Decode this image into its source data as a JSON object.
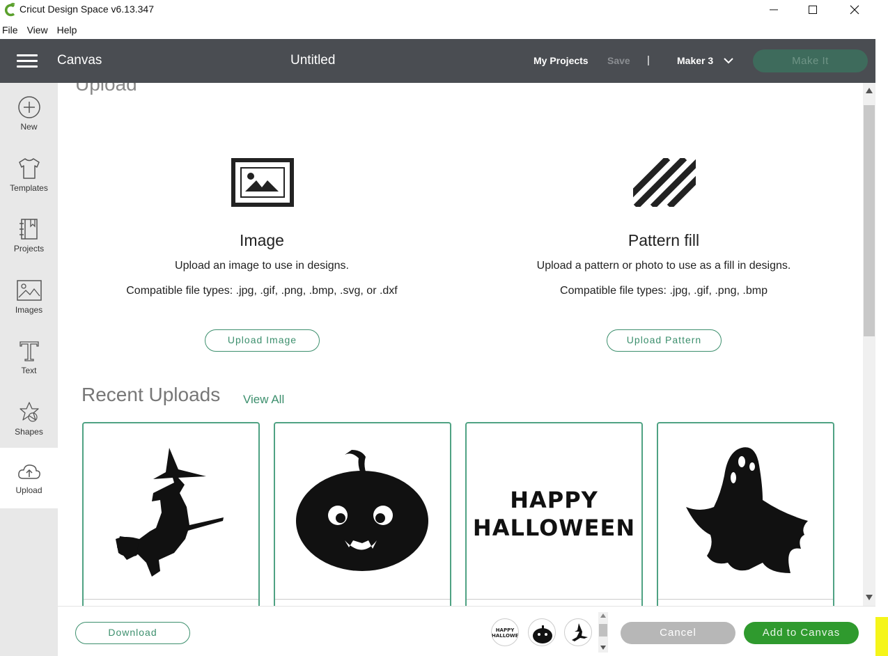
{
  "window": {
    "title": "Cricut Design Space  v6.13.347",
    "minimize_glyph": "—",
    "maximize_glyph": "☐",
    "close_glyph": "✕"
  },
  "menu": {
    "items": [
      "File",
      "View",
      "Help"
    ]
  },
  "topbar": {
    "canvas_label": "Canvas",
    "document_title": "Untitled",
    "my_projects": "My Projects",
    "save": "Save",
    "separator": "|",
    "machine": "Maker 3",
    "make_it": "Make It"
  },
  "sidebar": {
    "items": [
      {
        "label": "New",
        "icon": "plus-circle-icon"
      },
      {
        "label": "Templates",
        "icon": "tshirt-icon"
      },
      {
        "label": "Projects",
        "icon": "notebook-icon"
      },
      {
        "label": "Images",
        "icon": "image-icon"
      },
      {
        "label": "Text",
        "icon": "text-T-icon"
      },
      {
        "label": "Shapes",
        "icon": "shapes-icon"
      },
      {
        "label": "Upload",
        "icon": "cloud-upload-icon",
        "active": true
      }
    ]
  },
  "upload": {
    "section_title": "Upload",
    "image": {
      "heading": "Image",
      "description": "Upload an image to use in designs.",
      "types": "Compatible file types: .jpg, .gif, .png, .bmp, .svg, or .dxf",
      "button": "Upload Image"
    },
    "pattern": {
      "heading": "Pattern fill",
      "description": "Upload a pattern or photo to use as a fill in designs.",
      "types": "Compatible file types: .jpg, .gif, .png, .bmp",
      "button": "Upload Pattern"
    }
  },
  "recent": {
    "title": "Recent Uploads",
    "view_all": "View All",
    "items": [
      {
        "name": "witch-silhouette"
      },
      {
        "name": "jack-o-lantern"
      },
      {
        "name": "happy-halloween-text",
        "line1": "HAPPY",
        "line2": "HALLOWEEN"
      },
      {
        "name": "ghost-silhouette"
      }
    ]
  },
  "bottombar": {
    "download": "Download",
    "thumb_text": "HAPPY HALLOWEEN",
    "cancel": "Cancel",
    "add_to_canvas": "Add to Canvas"
  },
  "colors": {
    "topbar": "#4a4d52",
    "accent_green": "#3c8f6d",
    "add_button": "#2f9a2e",
    "highlight": "#f5f51a"
  }
}
